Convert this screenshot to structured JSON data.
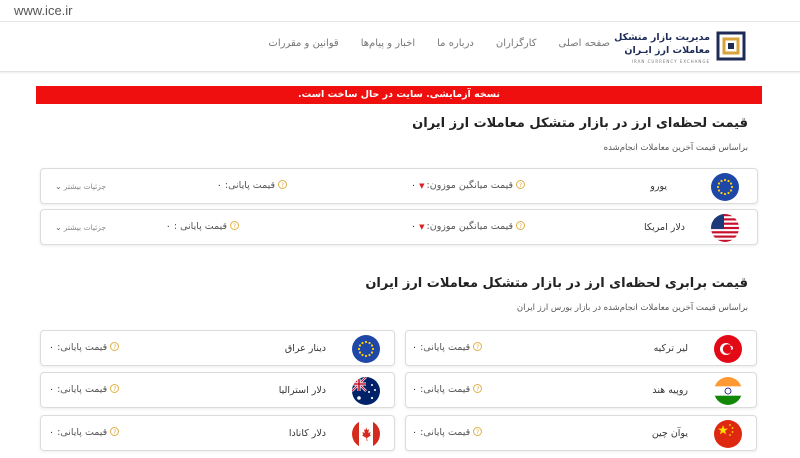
{
  "browser": {
    "url": "www.ice.ir"
  },
  "logo": {
    "line1": "مدیریت بازار متشکل",
    "line2": "معاملات ارز ایـران",
    "line3": "IRAN CURRENCY EXCHANGE"
  },
  "nav": [
    "صفحه اصلی",
    "کارگزاران",
    "درباره ما",
    "اخبار و پیام‌ها",
    "قوانین و مقررات"
  ],
  "alert": "نسخه آزمایشی. سایت در حال ساخت است.",
  "section1": {
    "title": "قیمت لحظه‌ای ارز در بازار متشکل معاملات ارز ایران",
    "subtitle": "براساس قیمت آخرین معاملات انجام‌شده",
    "rows": [
      {
        "currency": "یورو",
        "flag": "eu-flag",
        "avg_label": "قیمت میانگین موزون:",
        "avg_value": "۰",
        "avg_trend": "▼",
        "final_label": "قیمت پایانی:",
        "final_value": "۰",
        "more": "جزئیات بیشتر"
      },
      {
        "currency": "دلار امریکا",
        "flag": "us-flag",
        "avg_label": "قیمت میانگین موزون:",
        "avg_value": "۰",
        "avg_trend": "▼",
        "final_label": "قیمت پایانی :",
        "final_value": "۰",
        "more": "جزئیات بیشتر"
      }
    ]
  },
  "section2": {
    "title": "قیمت برابری لحظه‌ای ارز در بازار متشکل معاملات ارز ایران",
    "subtitle": "براساس قیمت آخرین معاملات انجام‌شده در بازار بورس ارز ایران",
    "cards": [
      {
        "currency": "لیر ترکیه",
        "flag": "tr-flag",
        "final_label": "قیمت پایانی:",
        "final_value": "۰"
      },
      {
        "currency": "دینار عراق",
        "flag": "eu-flag",
        "final_label": "قیمت پایانی:",
        "final_value": "۰"
      },
      {
        "currency": "روپیه هند",
        "flag": "in-flag",
        "final_label": "قیمت پایانی:",
        "final_value": "۰"
      },
      {
        "currency": "دلار استرالیا",
        "flag": "au-flag",
        "final_label": "قیمت پایانی:",
        "final_value": "۰"
      },
      {
        "currency": "یوآن چین",
        "flag": "cn-flag",
        "final_label": "قیمت پایانی:",
        "final_value": "۰"
      },
      {
        "currency": "دلار کانادا",
        "flag": "ca-flag",
        "final_label": "قیمت پایانی:",
        "final_value": "۰"
      }
    ]
  },
  "colors": {
    "alert": "#ef0f0f",
    "brand": "#1d2b55",
    "accent": "#e0b04a",
    "down": "#e02020"
  }
}
